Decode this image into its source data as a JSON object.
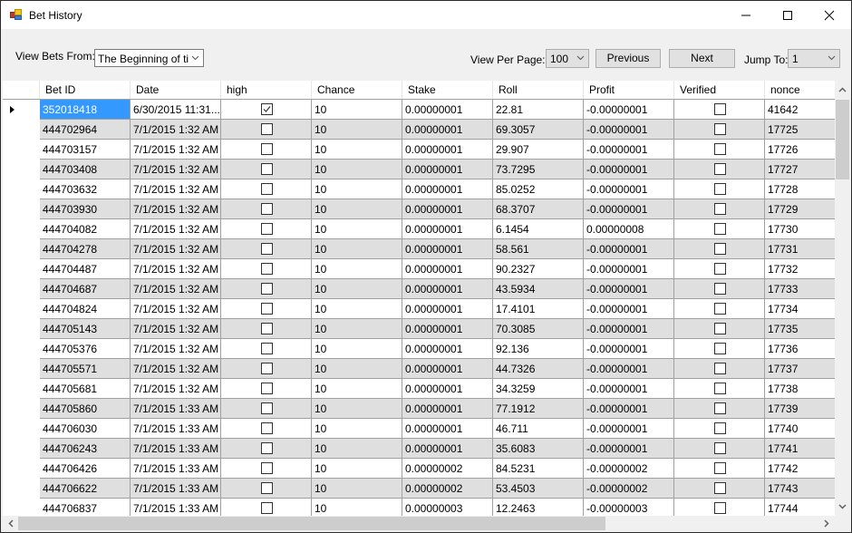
{
  "window": {
    "title": "Bet History",
    "icon": "app-icon",
    "controls": [
      "minimize-icon",
      "maximize-icon",
      "close-icon"
    ]
  },
  "toolbar": {
    "view_bets_from_label": "View Bets From:",
    "view_bets_from_value": "The Beginning of time",
    "view_bets_from_display": "The Beginning of tim",
    "view_per_page_label": "View Per Page:",
    "view_per_page_value": "100",
    "previous_label": "Previous",
    "next_label": "Next",
    "jump_to_label": "Jump To:",
    "jump_to_value": "1"
  },
  "grid": {
    "columns": [
      "Bet ID",
      "Date",
      "high",
      "Chance",
      "Stake",
      "Roll",
      "Profit",
      "Verified",
      "nonce"
    ],
    "selected_row": 0,
    "rows": [
      {
        "bet_id": "352018418",
        "date": "6/30/2015 11:31...",
        "high": true,
        "chance": "10",
        "stake": "0.00000001",
        "roll": "22.81",
        "profit": "-0.00000001",
        "verified": false,
        "nonce": "41642"
      },
      {
        "bet_id": "444702964",
        "date": "7/1/2015 1:32 AM",
        "high": false,
        "chance": "10",
        "stake": "0.00000001",
        "roll": "69.3057",
        "profit": "-0.00000001",
        "verified": false,
        "nonce": "17725"
      },
      {
        "bet_id": "444703157",
        "date": "7/1/2015 1:32 AM",
        "high": false,
        "chance": "10",
        "stake": "0.00000001",
        "roll": "29.907",
        "profit": "-0.00000001",
        "verified": false,
        "nonce": "17726"
      },
      {
        "bet_id": "444703408",
        "date": "7/1/2015 1:32 AM",
        "high": false,
        "chance": "10",
        "stake": "0.00000001",
        "roll": "73.7295",
        "profit": "-0.00000001",
        "verified": false,
        "nonce": "17727"
      },
      {
        "bet_id": "444703632",
        "date": "7/1/2015 1:32 AM",
        "high": false,
        "chance": "10",
        "stake": "0.00000001",
        "roll": "85.0252",
        "profit": "-0.00000001",
        "verified": false,
        "nonce": "17728"
      },
      {
        "bet_id": "444703930",
        "date": "7/1/2015 1:32 AM",
        "high": false,
        "chance": "10",
        "stake": "0.00000001",
        "roll": "68.3707",
        "profit": "-0.00000001",
        "verified": false,
        "nonce": "17729"
      },
      {
        "bet_id": "444704082",
        "date": "7/1/2015 1:32 AM",
        "high": false,
        "chance": "10",
        "stake": "0.00000001",
        "roll": "6.1454",
        "profit": "0.00000008",
        "verified": false,
        "nonce": "17730"
      },
      {
        "bet_id": "444704278",
        "date": "7/1/2015 1:32 AM",
        "high": false,
        "chance": "10",
        "stake": "0.00000001",
        "roll": "58.561",
        "profit": "-0.00000001",
        "verified": false,
        "nonce": "17731"
      },
      {
        "bet_id": "444704487",
        "date": "7/1/2015 1:32 AM",
        "high": false,
        "chance": "10",
        "stake": "0.00000001",
        "roll": "90.2327",
        "profit": "-0.00000001",
        "verified": false,
        "nonce": "17732"
      },
      {
        "bet_id": "444704687",
        "date": "7/1/2015 1:32 AM",
        "high": false,
        "chance": "10",
        "stake": "0.00000001",
        "roll": "43.5934",
        "profit": "-0.00000001",
        "verified": false,
        "nonce": "17733"
      },
      {
        "bet_id": "444704824",
        "date": "7/1/2015 1:32 AM",
        "high": false,
        "chance": "10",
        "stake": "0.00000001",
        "roll": "17.4101",
        "profit": "-0.00000001",
        "verified": false,
        "nonce": "17734"
      },
      {
        "bet_id": "444705143",
        "date": "7/1/2015 1:32 AM",
        "high": false,
        "chance": "10",
        "stake": "0.00000001",
        "roll": "70.3085",
        "profit": "-0.00000001",
        "verified": false,
        "nonce": "17735"
      },
      {
        "bet_id": "444705376",
        "date": "7/1/2015 1:32 AM",
        "high": false,
        "chance": "10",
        "stake": "0.00000001",
        "roll": "92.136",
        "profit": "-0.00000001",
        "verified": false,
        "nonce": "17736"
      },
      {
        "bet_id": "444705571",
        "date": "7/1/2015 1:32 AM",
        "high": false,
        "chance": "10",
        "stake": "0.00000001",
        "roll": "44.7326",
        "profit": "-0.00000001",
        "verified": false,
        "nonce": "17737"
      },
      {
        "bet_id": "444705681",
        "date": "7/1/2015 1:32 AM",
        "high": false,
        "chance": "10",
        "stake": "0.00000001",
        "roll": "34.3259",
        "profit": "-0.00000001",
        "verified": false,
        "nonce": "17738"
      },
      {
        "bet_id": "444705860",
        "date": "7/1/2015 1:33 AM",
        "high": false,
        "chance": "10",
        "stake": "0.00000001",
        "roll": "77.1912",
        "profit": "-0.00000001",
        "verified": false,
        "nonce": "17739"
      },
      {
        "bet_id": "444706030",
        "date": "7/1/2015 1:33 AM",
        "high": false,
        "chance": "10",
        "stake": "0.00000001",
        "roll": "46.711",
        "profit": "-0.00000001",
        "verified": false,
        "nonce": "17740"
      },
      {
        "bet_id": "444706243",
        "date": "7/1/2015 1:33 AM",
        "high": false,
        "chance": "10",
        "stake": "0.00000001",
        "roll": "35.6083",
        "profit": "-0.00000001",
        "verified": false,
        "nonce": "17741"
      },
      {
        "bet_id": "444706426",
        "date": "7/1/2015 1:33 AM",
        "high": false,
        "chance": "10",
        "stake": "0.00000002",
        "roll": "84.5231",
        "profit": "-0.00000002",
        "verified": false,
        "nonce": "17742"
      },
      {
        "bet_id": "444706622",
        "date": "7/1/2015 1:33 AM",
        "high": false,
        "chance": "10",
        "stake": "0.00000002",
        "roll": "53.4503",
        "profit": "-0.00000002",
        "verified": false,
        "nonce": "17743"
      },
      {
        "bet_id": "444706837",
        "date": "7/1/2015 1:33 AM",
        "high": false,
        "chance": "10",
        "stake": "0.00000003",
        "roll": "12.2463",
        "profit": "-0.00000003",
        "verified": false,
        "nonce": "17744"
      }
    ]
  },
  "colors": {
    "selection": "#3399ff",
    "alt_row": "#dfdfdf",
    "window_bg": "#f0f0f0"
  }
}
